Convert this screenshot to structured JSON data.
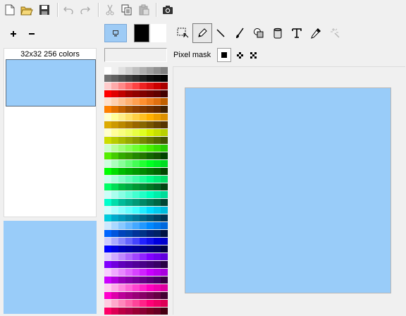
{
  "toolbar": {
    "buttons": [
      "new-icon",
      "open-icon",
      "save-icon",
      "undo-icon",
      "redo-icon",
      "cut-icon",
      "copy-icon",
      "paste-icon",
      "screenshot-icon"
    ]
  },
  "left_panel": {
    "add_icon": "plus-icon",
    "remove_icon": "minus-icon",
    "image_label": "32x32 256 colors",
    "preview_color": "#99ccf9"
  },
  "colors": {
    "primary": "#000000",
    "secondary": "#ffffff"
  },
  "tools": [
    "select-icon",
    "pencil-icon",
    "line-icon",
    "brush-icon",
    "shapes-icon",
    "fill-bucket-icon",
    "text-icon",
    "eyedropper-icon",
    "magic-wand-icon"
  ],
  "mask": {
    "label": "Pixel mask",
    "options": [
      "solid-square-icon",
      "four-dot-icon",
      "x-dot-icon"
    ]
  },
  "canvas": {
    "color": "#99ccf9"
  },
  "palette": [
    [
      "#ffffff",
      "#f0f0f0",
      "#e0e0e0",
      "#d0d0d0",
      "#c0c0c0",
      "#b0b0b0",
      "#a0a0a0",
      "#909090",
      "#808080"
    ],
    [
      "#707070",
      "#606060",
      "#505050",
      "#404040",
      "#303030",
      "#202020",
      "#101010",
      "#080808",
      "#000000"
    ],
    [
      "#ffcccc",
      "#ffaaaa",
      "#ff8888",
      "#ff6666",
      "#ff4444",
      "#ee2222",
      "#dd1111",
      "#cc0000",
      "#aa0000"
    ],
    [
      "#ff0000",
      "#e00000",
      "#c00000",
      "#a00000",
      "#900000",
      "#800000",
      "#700000",
      "#600000",
      "#400000"
    ],
    [
      "#ffe0cc",
      "#ffd0b0",
      "#ffc090",
      "#ffb070",
      "#ffa050",
      "#ff9030",
      "#f08020",
      "#e07010",
      "#c06000"
    ],
    [
      "#ff8000",
      "#e07000",
      "#c06000",
      "#a05000",
      "#904000",
      "#803800",
      "#703000",
      "#602800",
      "#402000"
    ],
    [
      "#ffffcc",
      "#ffff99",
      "#ffee88",
      "#ffe066",
      "#ffd044",
      "#ffc022",
      "#ffb000",
      "#eea000",
      "#dd9000"
    ],
    [
      "#ddaa00",
      "#cc9900",
      "#bb8800",
      "#aa7700",
      "#996600",
      "#886600",
      "#775500",
      "#664400",
      "#553300"
    ],
    [
      "#ffffcc",
      "#ffff99",
      "#f8ff80",
      "#f0ff66",
      "#e8ff44",
      "#e0ff22",
      "#d8f000",
      "#c8e000",
      "#b8d000"
    ],
    [
      "#ccdd00",
      "#b8cc00",
      "#a8bb00",
      "#98aa00",
      "#889900",
      "#778800",
      "#667700",
      "#556600",
      "#445500"
    ],
    [
      "#ccffcc",
      "#b8ff99",
      "#a0ff77",
      "#88ff55",
      "#70ff33",
      "#58ff11",
      "#48ee00",
      "#38dd00",
      "#28cc00"
    ],
    [
      "#55ee00",
      "#44cc00",
      "#33aa00",
      "#339900",
      "#228800",
      "#227700",
      "#116600",
      "#115500",
      "#004400"
    ],
    [
      "#ccffdd",
      "#aaffbb",
      "#88ff99",
      "#66ff77",
      "#44ff55",
      "#22ff33",
      "#00ff22",
      "#00ee22",
      "#00dd22"
    ],
    [
      "#00ff00",
      "#00dd00",
      "#00bb00",
      "#00aa00",
      "#009900",
      "#008800",
      "#007700",
      "#006600",
      "#004400"
    ],
    [
      "#ccffee",
      "#aaffdd",
      "#88ffcc",
      "#66ffbb",
      "#44ffaa",
      "#22ff99",
      "#00ff88",
      "#00ee77",
      "#00dd66"
    ],
    [
      "#00ff66",
      "#00dd55",
      "#00bb44",
      "#00aa44",
      "#009933",
      "#008833",
      "#007722",
      "#006622",
      "#004411"
    ],
    [
      "#ccfff8",
      "#aaffee",
      "#88ffe4",
      "#66ffda",
      "#44ffd0",
      "#22ffc6",
      "#00ffbc",
      "#00eeaa",
      "#00dd99"
    ],
    [
      "#00ffcc",
      "#00ddaa",
      "#00bb99",
      "#00aa88",
      "#009977",
      "#008866",
      "#007755",
      "#006644",
      "#004433"
    ],
    [
      "#ccffff",
      "#aaffff",
      "#88ffff",
      "#66ffff",
      "#44ffff",
      "#22eeff",
      "#00ddff",
      "#00ccee",
      "#00bbdd"
    ],
    [
      "#00ccdd",
      "#00aacc",
      "#0099bb",
      "#0088aa",
      "#007799",
      "#006688",
      "#005577",
      "#004466",
      "#003355"
    ],
    [
      "#cce8ff",
      "#aad8ff",
      "#88c8ff",
      "#66b8ff",
      "#44a8ff",
      "#2298ff",
      "#0088ff",
      "#0078ee",
      "#0068dd"
    ],
    [
      "#0066ff",
      "#0055dd",
      "#0044bb",
      "#0044aa",
      "#003399",
      "#003388",
      "#002277",
      "#002266",
      "#001144"
    ],
    [
      "#ccccff",
      "#aaaaff",
      "#8888ff",
      "#6666ff",
      "#4444ff",
      "#2222ff",
      "#1111ee",
      "#0000dd",
      "#0000cc"
    ],
    [
      "#0000ff",
      "#0000dd",
      "#0000bb",
      "#0000aa",
      "#000099",
      "#000088",
      "#000077",
      "#000066",
      "#000044"
    ],
    [
      "#e0ccff",
      "#d0aaff",
      "#c088ff",
      "#b066ff",
      "#a044ff",
      "#9022ff",
      "#8000ff",
      "#7000ee",
      "#6000dd"
    ],
    [
      "#8000ff",
      "#7000dd",
      "#6000bb",
      "#5800aa",
      "#500099",
      "#480088",
      "#400077",
      "#380066",
      "#280044"
    ],
    [
      "#f8ccff",
      "#f0aaff",
      "#e888ff",
      "#e066ff",
      "#d844ff",
      "#d022ff",
      "#c800ff",
      "#b800ee",
      "#a800dd"
    ],
    [
      "#cc00ff",
      "#b000dd",
      "#9800bb",
      "#8800aa",
      "#780099",
      "#680088",
      "#580077",
      "#480066",
      "#380044"
    ],
    [
      "#ffccf0",
      "#ffaae8",
      "#ff88e0",
      "#ff66d8",
      "#ff44d0",
      "#ff22c8",
      "#ff00c0",
      "#ee00b0",
      "#dd00a0"
    ],
    [
      "#ff00cc",
      "#dd00aa",
      "#bb0099",
      "#aa0088",
      "#990077",
      "#880066",
      "#770055",
      "#660044",
      "#440033"
    ],
    [
      "#ffcce0",
      "#ffaacc",
      "#ff88bb",
      "#ff66aa",
      "#ff4499",
      "#ff2288",
      "#ff0077",
      "#ee0066",
      "#dd0055"
    ],
    [
      "#ff0066",
      "#dd0055",
      "#bb0044",
      "#aa0044",
      "#990033",
      "#880033",
      "#770022",
      "#660022",
      "#440011"
    ]
  ]
}
